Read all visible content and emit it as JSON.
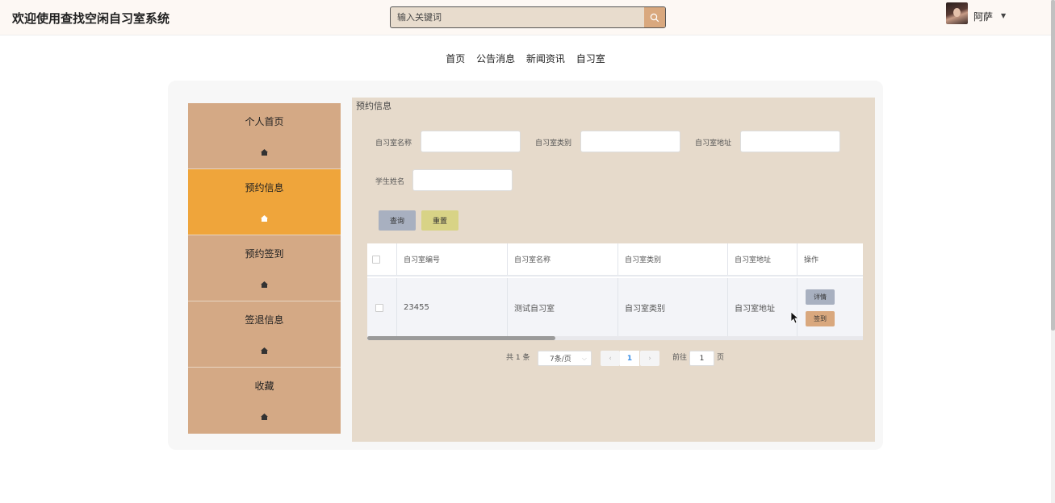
{
  "header": {
    "app_title": "欢迎使用查找空闲自习室系统",
    "search_placeholder": "输入关键词",
    "username": "阿萨",
    "search_icon": "search-icon",
    "caret_icon": "caret-down-icon"
  },
  "nav": {
    "items": [
      {
        "label": "首页"
      },
      {
        "label": "公告消息"
      },
      {
        "label": "新闻资讯"
      },
      {
        "label": "自习室"
      }
    ]
  },
  "sidebar": {
    "items": [
      {
        "label": "个人首页",
        "icon": "home-icon",
        "active": false
      },
      {
        "label": "预约信息",
        "icon": "home-icon",
        "active": true
      },
      {
        "label": "预约签到",
        "icon": "home-icon",
        "active": false
      },
      {
        "label": "签退信息",
        "icon": "home-icon",
        "active": false
      },
      {
        "label": "收藏",
        "icon": "home-icon",
        "active": false
      }
    ]
  },
  "main": {
    "section_title": "预约信息",
    "filters": {
      "room_name_label": "自习室名称",
      "room_type_label": "自习室类别",
      "room_address_label": "自习室地址",
      "student_name_label": "学生姓名"
    },
    "buttons": {
      "query": "查询",
      "reset": "重置"
    },
    "table": {
      "columns": [
        "自习室编号",
        "自习室名称",
        "自习室类别",
        "自习室地址",
        "操作"
      ],
      "rows": [
        {
          "room_id": "23455",
          "room_name": "测试自习室",
          "room_type": "自习室类别",
          "room_address": "自习室地址",
          "actions": [
            "详情",
            "签到"
          ]
        }
      ]
    },
    "pagination": {
      "total_text": "共 1 条",
      "page_size": "7条/页",
      "current_page": "1",
      "goto_label": "前往",
      "goto_value": "1",
      "page_suffix": "页"
    }
  },
  "colors": {
    "sidebar_bg": "#d4a985",
    "sidebar_active": "#efa53b",
    "content_bg": "#e6dacb",
    "query_btn": "#a8b0c0",
    "reset_btn": "#d8d386",
    "detail_btn": "#a8b0c0",
    "checkin_btn": "#d9a87e"
  }
}
